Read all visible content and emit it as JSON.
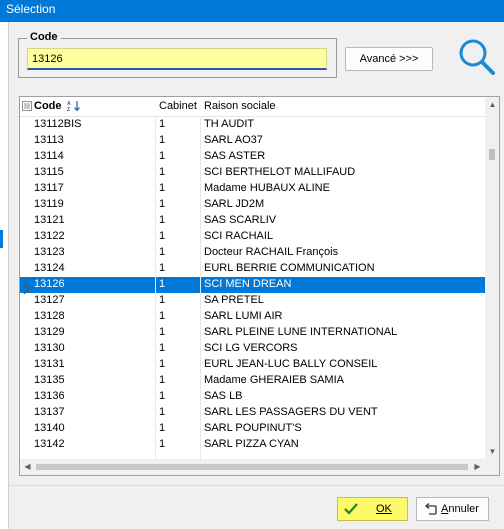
{
  "window": {
    "title": "Sélection"
  },
  "code_filter": {
    "legend": "Code",
    "value": "13126"
  },
  "buttons": {
    "advanced": "Avancé >>>",
    "ok": "OK",
    "cancel_underlined": "A",
    "cancel_rest": "nnuler"
  },
  "grid": {
    "columns": {
      "code": "Code",
      "cabinet": "Cabinet",
      "raison_sociale": "Raison sociale"
    },
    "sort_icon": "sort-az-icon",
    "rows": [
      {
        "code": "13112BIS",
        "cabinet": "1",
        "raison_sociale": "TH AUDIT"
      },
      {
        "code": "13113",
        "cabinet": "1",
        "raison_sociale": "SARL AO37"
      },
      {
        "code": "13114",
        "cabinet": "1",
        "raison_sociale": "SAS ASTER"
      },
      {
        "code": "13115",
        "cabinet": "1",
        "raison_sociale": "SCI BERTHELOT MALLIFAUD"
      },
      {
        "code": "13117",
        "cabinet": "1",
        "raison_sociale": "Madame HUBAUX ALINE"
      },
      {
        "code": "13119",
        "cabinet": "1",
        "raison_sociale": "SARL JD2M"
      },
      {
        "code": "13121",
        "cabinet": "1",
        "raison_sociale": "SAS SCARLIV"
      },
      {
        "code": "13122",
        "cabinet": "1",
        "raison_sociale": "SCI RACHAIL"
      },
      {
        "code": "13123",
        "cabinet": "1",
        "raison_sociale": "Docteur RACHAIL François"
      },
      {
        "code": "13124",
        "cabinet": "1",
        "raison_sociale": "EURL BERRIE COMMUNICATION"
      },
      {
        "code": "13126",
        "cabinet": "1",
        "raison_sociale": "SCI MEN DREAN"
      },
      {
        "code": "13127",
        "cabinet": "1",
        "raison_sociale": "SA PRETEL"
      },
      {
        "code": "13128",
        "cabinet": "1",
        "raison_sociale": "SARL LUMI AIR"
      },
      {
        "code": "13129",
        "cabinet": "1",
        "raison_sociale": "SARL PLEINE LUNE INTERNATIONAL"
      },
      {
        "code": "13130",
        "cabinet": "1",
        "raison_sociale": "SCI LG VERCORS"
      },
      {
        "code": "13131",
        "cabinet": "1",
        "raison_sociale": "EURL JEAN-LUC BALLY CONSEIL"
      },
      {
        "code": "13135",
        "cabinet": "1",
        "raison_sociale": "Madame GHERAIEB SAMIA"
      },
      {
        "code": "13136",
        "cabinet": "1",
        "raison_sociale": "SAS LB"
      },
      {
        "code": "13137",
        "cabinet": "1",
        "raison_sociale": "SARL LES PASSAGERS DU VENT"
      },
      {
        "code": "13140",
        "cabinet": "1",
        "raison_sociale": "SARL POUPINUT'S"
      },
      {
        "code": "13142",
        "cabinet": "1",
        "raison_sociale": "SARL PIZZA CYAN"
      }
    ],
    "selected_code": "13126"
  },
  "colors": {
    "title_bar": "#0078d7",
    "selection": "#0078d7",
    "input_bg": "#ffff9e",
    "ok_bg": "#fdf96a"
  }
}
